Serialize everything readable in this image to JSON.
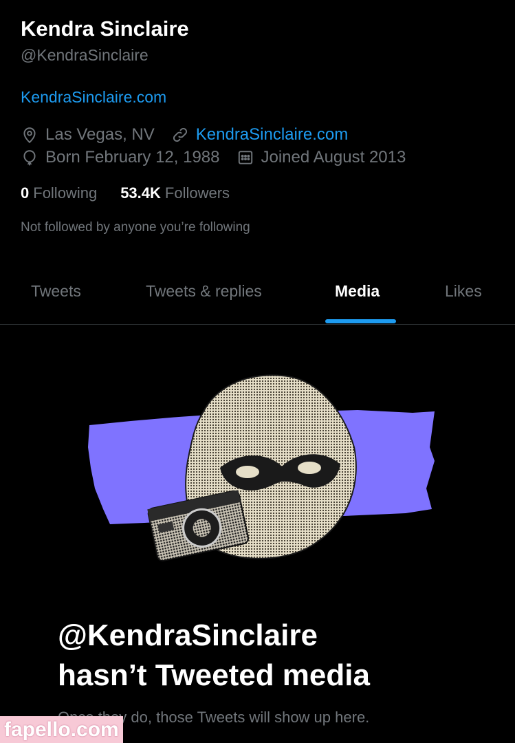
{
  "profile": {
    "name": "Kendra Sinclaire",
    "handle": "@KendraSinclaire",
    "bio_link": "KendraSinclaire.com",
    "location": "Las Vegas, NV",
    "website": "KendraSinclaire.com",
    "born": "Born February 12, 1988",
    "joined": "Joined August 2013",
    "following_count": "0",
    "following_label": "Following",
    "followers_count": "53.4K",
    "followers_label": "Followers",
    "not_followed": "Not followed by anyone you’re following"
  },
  "tabs": [
    {
      "label": "Tweets"
    },
    {
      "label": "Tweets & replies"
    },
    {
      "label": "Media"
    },
    {
      "label": "Likes"
    }
  ],
  "active_tab": "Media",
  "empty_state": {
    "title_line1": "@KendraSinclaire",
    "title_line2": "hasn’t Tweeted media",
    "subtitle": "Once they do, those Tweets will show up here."
  },
  "watermark": "fapello.com",
  "colors": {
    "background": "#000000",
    "accent": "#1d9bf0",
    "muted": "#71767b",
    "illustration_band": "#7f73ff"
  },
  "icons": [
    "location-icon",
    "link-icon",
    "birthday-balloon-icon",
    "calendar-icon"
  ]
}
